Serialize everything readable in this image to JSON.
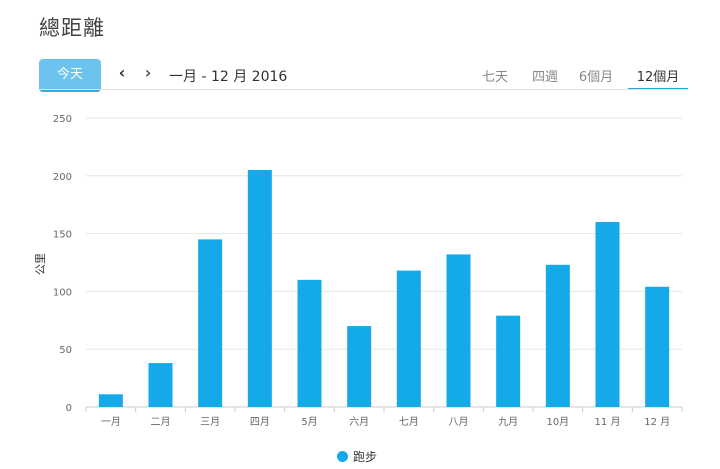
{
  "header": {
    "title": "總距離",
    "today_label": "今天",
    "prev_icon": "chevron-left-icon",
    "next_icon": "chevron-right-icon",
    "range_label": "一月 - 12 月 2016"
  },
  "tabs": [
    {
      "label": "七天",
      "active": false
    },
    {
      "label": "四週",
      "active": false
    },
    {
      "label": "6個月",
      "active": false
    },
    {
      "label": "12個月",
      "active": true
    }
  ],
  "colors": {
    "bar": "#14aae9",
    "accent": "#29a5dc",
    "today_button": "#6cc4ee"
  },
  "chart_data": {
    "type": "bar",
    "categories": [
      "一月",
      "二月",
      "三月",
      "四月",
      "5月",
      "六月",
      "七月",
      "八月",
      "九月",
      "10月",
      "11 月",
      "12 月"
    ],
    "series": [
      {
        "name": "跑步",
        "values": [
          11,
          38,
          145,
          205,
          110,
          70,
          118,
          132,
          79,
          123,
          160,
          104
        ]
      }
    ],
    "ylabel": "公里",
    "ylim": [
      0,
      250
    ],
    "yticks": [
      "0",
      "50",
      "100",
      "150",
      "200",
      "250"
    ],
    "grid": true,
    "legend": "bottom-center"
  }
}
